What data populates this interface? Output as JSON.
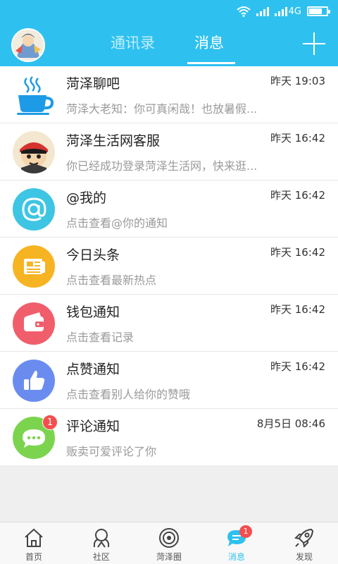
{
  "status_bar": {
    "network": "4G",
    "battery_level": 0.7
  },
  "header": {
    "tabs": [
      {
        "label": "通讯录",
        "active": false
      },
      {
        "label": "消息",
        "active": true
      }
    ]
  },
  "messages": [
    {
      "title": "菏泽聊吧",
      "preview": "菏泽大老知：你可真闲哉！也放暑假...",
      "time": "昨天 19:03",
      "icon": "coffee-cup-icon"
    },
    {
      "title": "菏泽生活网客服",
      "preview": "你已经成功登录菏泽生活网，快来逛...",
      "time": "昨天 16:42",
      "icon": "cartoon-avatar"
    },
    {
      "title": "@我的",
      "preview": "点击查看@你的通知",
      "time": "昨天 16:42",
      "icon": "at-sign-icon"
    },
    {
      "title": "今日头条",
      "preview": "点击查看最新热点",
      "time": "昨天 16:42",
      "icon": "newspaper-icon"
    },
    {
      "title": "钱包通知",
      "preview": "点击查看记录",
      "time": "昨天 16:42",
      "icon": "wallet-icon"
    },
    {
      "title": "点赞通知",
      "preview": "点击查看别人给你的赞哦",
      "time": "昨天 16:42",
      "icon": "thumbs-up-icon"
    },
    {
      "title": "评论通知",
      "preview": "贩卖可爱评论了你",
      "time": "8月5日 08:46",
      "icon": "comment-icon",
      "badge": "1"
    }
  ],
  "tabbar": [
    {
      "label": "首页",
      "icon": "home-icon"
    },
    {
      "label": "社区",
      "icon": "community-icon"
    },
    {
      "label": "菏泽圈",
      "icon": "circle-icon"
    },
    {
      "label": "消息",
      "icon": "message-icon",
      "active": true,
      "badge": "1"
    },
    {
      "label": "发现",
      "icon": "rocket-icon"
    }
  ],
  "colors": {
    "accent": "#2ec1ef",
    "at_bg": "#3ec5e3",
    "news_bg": "#f7b422",
    "wallet_bg": "#f05e6c",
    "like_bg": "#6b8cef",
    "comment_bg": "#7cd44e",
    "badge": "#f44e4e"
  }
}
